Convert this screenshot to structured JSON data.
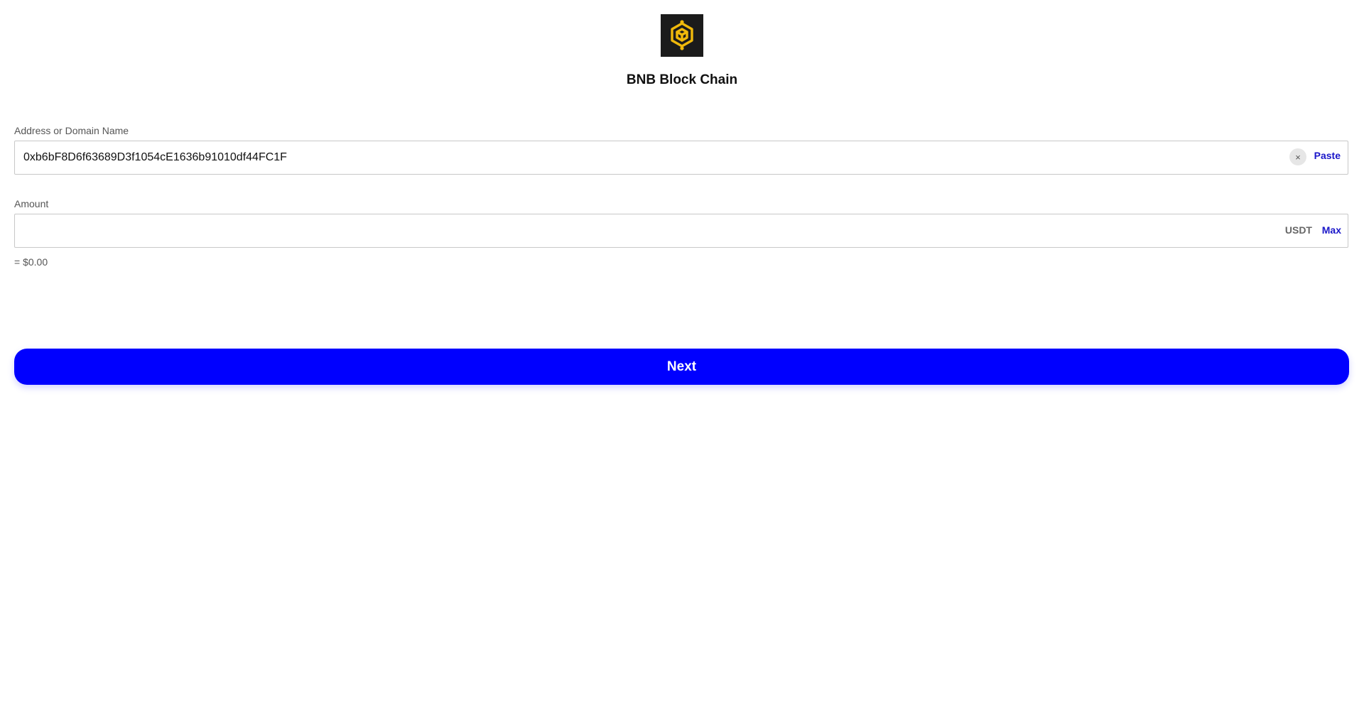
{
  "header": {
    "logo_icon": "bnb-chain-logo-icon",
    "title": "BNB Block Chain"
  },
  "address_field": {
    "label": "Address or Domain Name",
    "value": "0xb6bF8D6f63689D3f1054cE1636b91010df44FC1F",
    "clear_label": "×",
    "paste_label": "Paste"
  },
  "amount_field": {
    "label": "Amount",
    "value": "",
    "unit": "USDT",
    "max_label": "Max",
    "usd_value": "= $0.00"
  },
  "next_button": {
    "label": "Next"
  },
  "colors": {
    "accent": "#0000ff",
    "link": "#1a16c9",
    "logo_bg": "#1b1b1b",
    "logo_gold": "#f0b90b"
  }
}
